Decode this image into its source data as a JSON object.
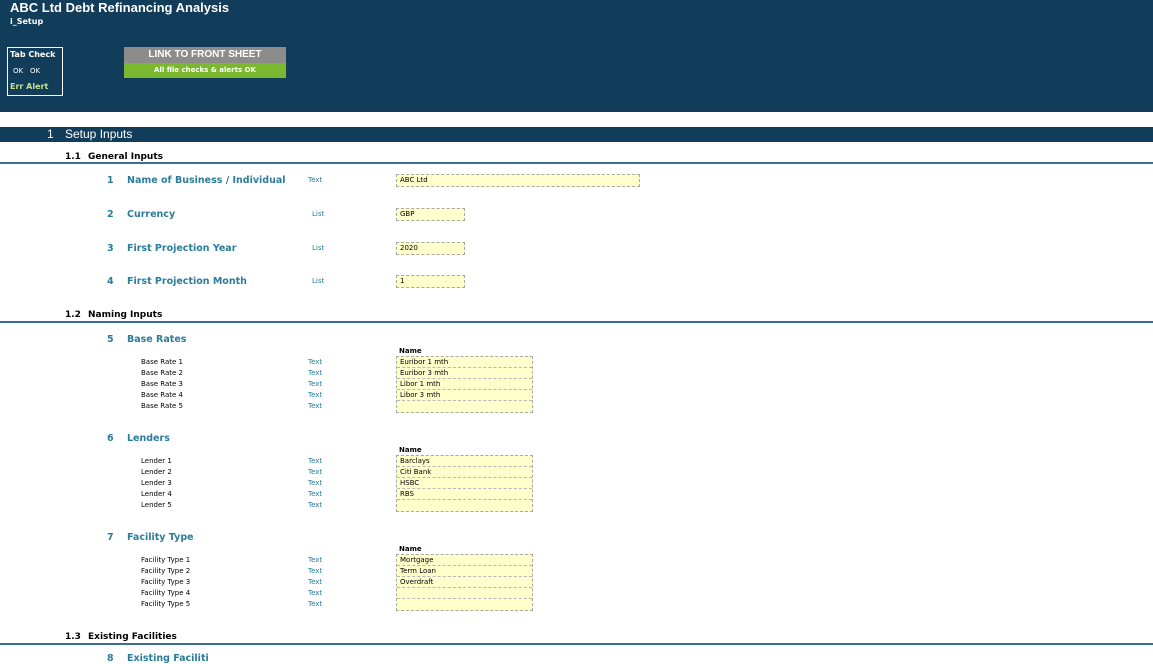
{
  "header": {
    "title": "ABC Ltd Debt Refinancing Analysis",
    "sheet": "i_Setup",
    "tab_check": {
      "title": "Tab Check",
      "ok1": "OK",
      "ok2": "OK",
      "err_alert": "Err Alert"
    },
    "link_button": "LINK TO FRONT SHEET",
    "checks_status": "All file checks & alerts OK"
  },
  "section": {
    "number": "1",
    "title": "Setup Inputs"
  },
  "general": {
    "number": "1.1",
    "title": "General Inputs",
    "items": [
      {
        "num": "1",
        "label": "Name of Business / Individual",
        "type": "Text",
        "value": "ABC Ltd"
      },
      {
        "num": "2",
        "label": "Currency",
        "type": "List",
        "value": "GBP"
      },
      {
        "num": "3",
        "label": "First Projection Year",
        "type": "List",
        "value": "2020"
      },
      {
        "num": "4",
        "label": "First Projection Month",
        "type": "List",
        "value": "1"
      }
    ]
  },
  "naming": {
    "number": "1.2",
    "title": "Naming Inputs",
    "name_header": "Name",
    "base_rates": {
      "num": "5",
      "label": "Base Rates",
      "rows": [
        {
          "label": "Base Rate 1",
          "type": "Text",
          "value": "Euribor 1 mth"
        },
        {
          "label": "Base Rate 2",
          "type": "Text",
          "value": "Euribor 3 mth"
        },
        {
          "label": "Base Rate 3",
          "type": "Text",
          "value": "Libor 1 mth"
        },
        {
          "label": "Base Rate 4",
          "type": "Text",
          "value": "Libor 3 mth"
        },
        {
          "label": "Base Rate 5",
          "type": "Text",
          "value": ""
        }
      ]
    },
    "lenders": {
      "num": "6",
      "label": "Lenders",
      "rows": [
        {
          "label": "Lender 1",
          "type": "Text",
          "value": "Barclays"
        },
        {
          "label": "Lender 2",
          "type": "Text",
          "value": "Citi Bank"
        },
        {
          "label": "Lender 3",
          "type": "Text",
          "value": "HSBC"
        },
        {
          "label": "Lender 4",
          "type": "Text",
          "value": "RBS"
        },
        {
          "label": "Lender 5",
          "type": "Text",
          "value": ""
        }
      ]
    },
    "facility_type": {
      "num": "7",
      "label": "Facility Type",
      "rows": [
        {
          "label": "Facility Type 1",
          "type": "Text",
          "value": "Mortgage"
        },
        {
          "label": "Facility Type 2",
          "type": "Text",
          "value": "Term Loan"
        },
        {
          "label": "Facility Type 3",
          "type": "Text",
          "value": "Overdraft"
        },
        {
          "label": "Facility Type 4",
          "type": "Text",
          "value": ""
        },
        {
          "label": "Facility Type 5",
          "type": "Text",
          "value": ""
        }
      ]
    }
  },
  "existing": {
    "number": "1.3",
    "title": "Existing Facilities",
    "next_item": {
      "num": "8",
      "label": "Existing Faciliti"
    }
  }
}
